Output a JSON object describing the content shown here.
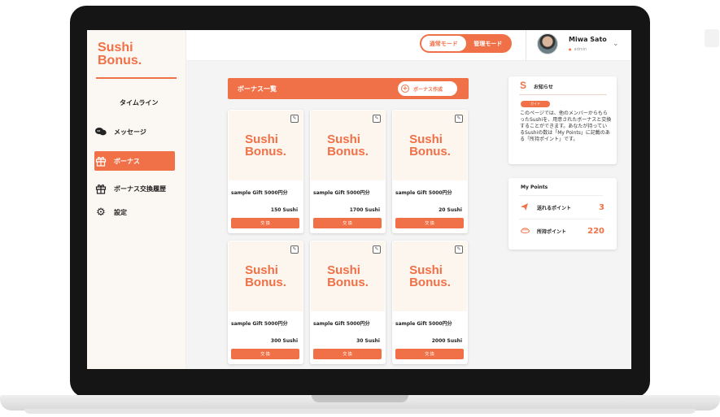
{
  "brand": {
    "line1": "Sushi",
    "line2": "Bonus.",
    "accent": "#f07147"
  },
  "sidebar": {
    "items": [
      {
        "label": "タイムライン",
        "icon": "none"
      },
      {
        "label": "メッセージ",
        "icon": "chat-bubbles-icon"
      },
      {
        "label": "ボーナス",
        "icon": "gift-icon",
        "active": true
      },
      {
        "label": "ボーナス交換履歴",
        "icon": "gift-icon"
      },
      {
        "label": "設定",
        "icon": "gear-icon"
      }
    ]
  },
  "topbar": {
    "modes": [
      "通常モード",
      "管理モード"
    ],
    "selected_mode": "通常モード",
    "user_name": "Miwa Sato",
    "user_role": "admin"
  },
  "bonus": {
    "title": "ボーナス一覧",
    "create_label": "ボーナス作成",
    "exchange_label": "交 換",
    "cards": [
      {
        "logo1": "Sushi",
        "logo2": "Bonus.",
        "gift": "sample Gift 5000円分",
        "points": "150 Sushi"
      },
      {
        "logo1": "Sushi",
        "logo2": "Bonus.",
        "gift": "sample Gift 5000円分",
        "points": "1700 Sushi"
      },
      {
        "logo1": "Sushi",
        "logo2": "Bonus.",
        "gift": "sample Gift 5000円分",
        "points": "20 Sushi"
      },
      {
        "logo1": "Sushi",
        "logo2": "Bonus.",
        "gift": "sample Gift 5000円分",
        "points": "300 Sushi"
      },
      {
        "logo1": "Sushi",
        "logo2": "Bonus.",
        "gift": "sample Gift 5000円分",
        "points": "30 Sushi"
      },
      {
        "logo1": "Sushi",
        "logo2": "Bonus.",
        "gift": "sample Gift 5000円分",
        "points": "2000 Sushi"
      }
    ]
  },
  "notice": {
    "icon": "S",
    "title": "お知らせ",
    "tag": "ガイド",
    "body": "このページでは、他のメンバーからもらったSushiを、用意されたボーナスと交換することができます。あなたが持っているSushiの数は「My Points」に記載のある「所持ポイント」です。"
  },
  "points": {
    "title": "My Points",
    "sent_label": "送れるポイント",
    "sent_value": "3",
    "owned_label": "所持ポイント",
    "owned_value": "220"
  }
}
